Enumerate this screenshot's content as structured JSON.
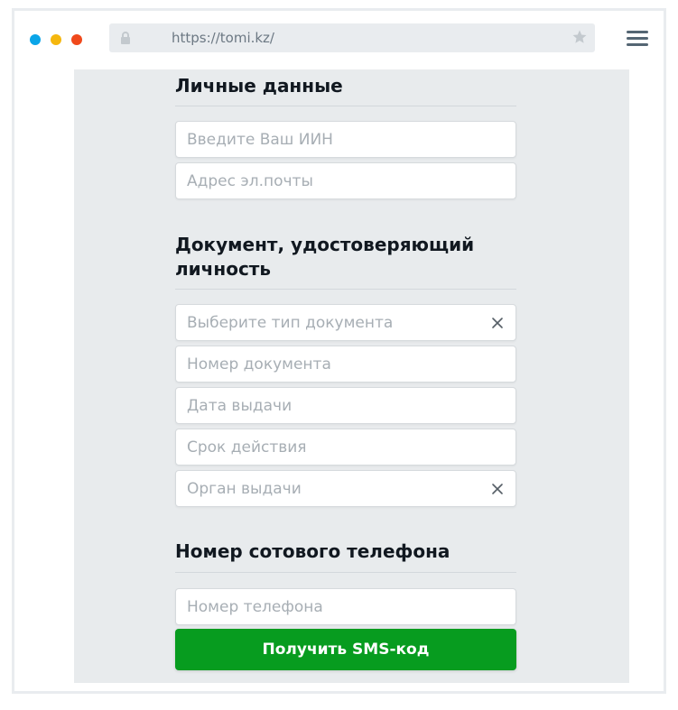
{
  "browser": {
    "url": "https://tomi.kz/",
    "icons": [
      "lock-icon",
      "star-icon",
      "menu-icon"
    ],
    "traffic_lights": [
      "#0aa5e8",
      "#f5b70e",
      "#f0491b"
    ]
  },
  "sections": {
    "personal": {
      "title": "Личные данные",
      "iin_placeholder": "Введите Ваш ИИН",
      "email_placeholder": "Адрес эл.почты"
    },
    "document": {
      "title": "Документ, удостоверяющий личность",
      "type_placeholder": "Выберите тип документа",
      "number_placeholder": "Номер документа",
      "issue_date_placeholder": "Дата выдачи",
      "expiry_placeholder": "Срок действия",
      "authority_placeholder": "Орган выдачи"
    },
    "phone": {
      "title": "Номер сотового телефона",
      "phone_placeholder": "Номер телефона",
      "button_label": "Получить SMS-код"
    }
  },
  "colors": {
    "accent_green": "#079c1f",
    "panel_background": "#e8ebed"
  }
}
